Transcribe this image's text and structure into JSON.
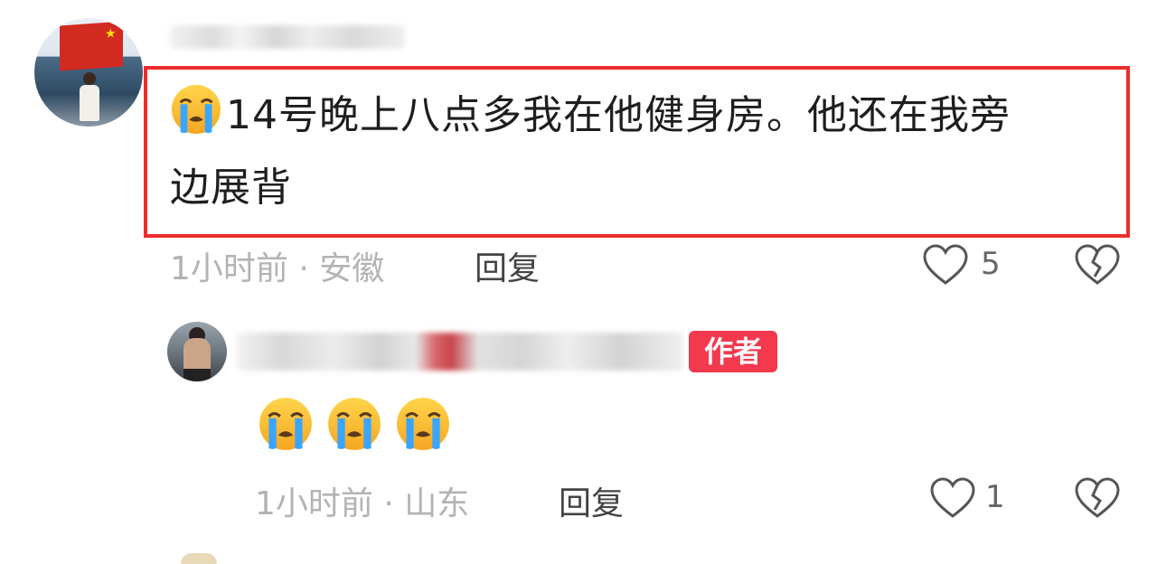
{
  "comments": [
    {
      "text_line1": "14号晚上八点多我在他健身房。他还在我旁",
      "text_line2": "边展背",
      "leading_emoji": "loudly-crying-face",
      "meta": "1小时前 · 安徽",
      "reply_label": "回复",
      "like_count": "5"
    }
  ],
  "reply": {
    "author_badge": "作者",
    "emojis": [
      "loudly-crying-face",
      "loudly-crying-face",
      "loudly-crying-face"
    ],
    "meta": "1小时前 · 山东",
    "reply_label": "回复",
    "like_count": "1"
  },
  "colors": {
    "highlight_border": "#ee2c2c",
    "author_badge_bg": "#f2394d",
    "meta_text": "#b3b3b3"
  }
}
